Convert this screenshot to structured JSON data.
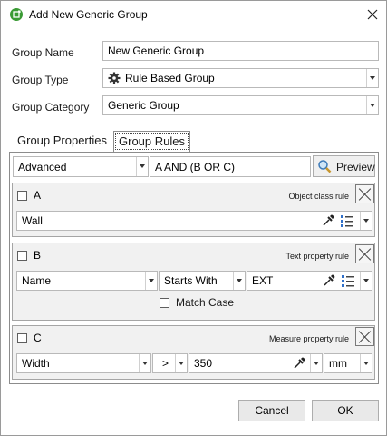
{
  "window": {
    "title": "Add New Generic Group"
  },
  "form": {
    "group_name_label": "Group Name",
    "group_name_value": "New Generic Group",
    "group_type_label": "Group Type",
    "group_type_value": "Rule Based Group",
    "group_category_label": "Group Category",
    "group_category_value": "Generic Group"
  },
  "tabs": [
    {
      "label": "Group Properties",
      "active": false
    },
    {
      "label": "Group Rules",
      "active": true
    }
  ],
  "rules_header": {
    "mode_value": "Advanced",
    "expression": "A AND (B OR C)",
    "preview_label": "Preview"
  },
  "rules": [
    {
      "letter": "A",
      "kind": "Object class rule",
      "value": "Wall"
    },
    {
      "letter": "B",
      "kind": "Text property rule",
      "property": "Name",
      "operator": "Starts With",
      "value": "EXT",
      "match_case_label": "Match Case"
    },
    {
      "letter": "C",
      "kind": "Measure property rule",
      "property": "Width",
      "operator": ">",
      "value": "350",
      "unit": "mm"
    }
  ],
  "buttons": {
    "cancel": "Cancel",
    "ok": "OK"
  },
  "colors": {
    "title_icon": "#3a9a34",
    "list_icon": "#2f6fc9"
  }
}
